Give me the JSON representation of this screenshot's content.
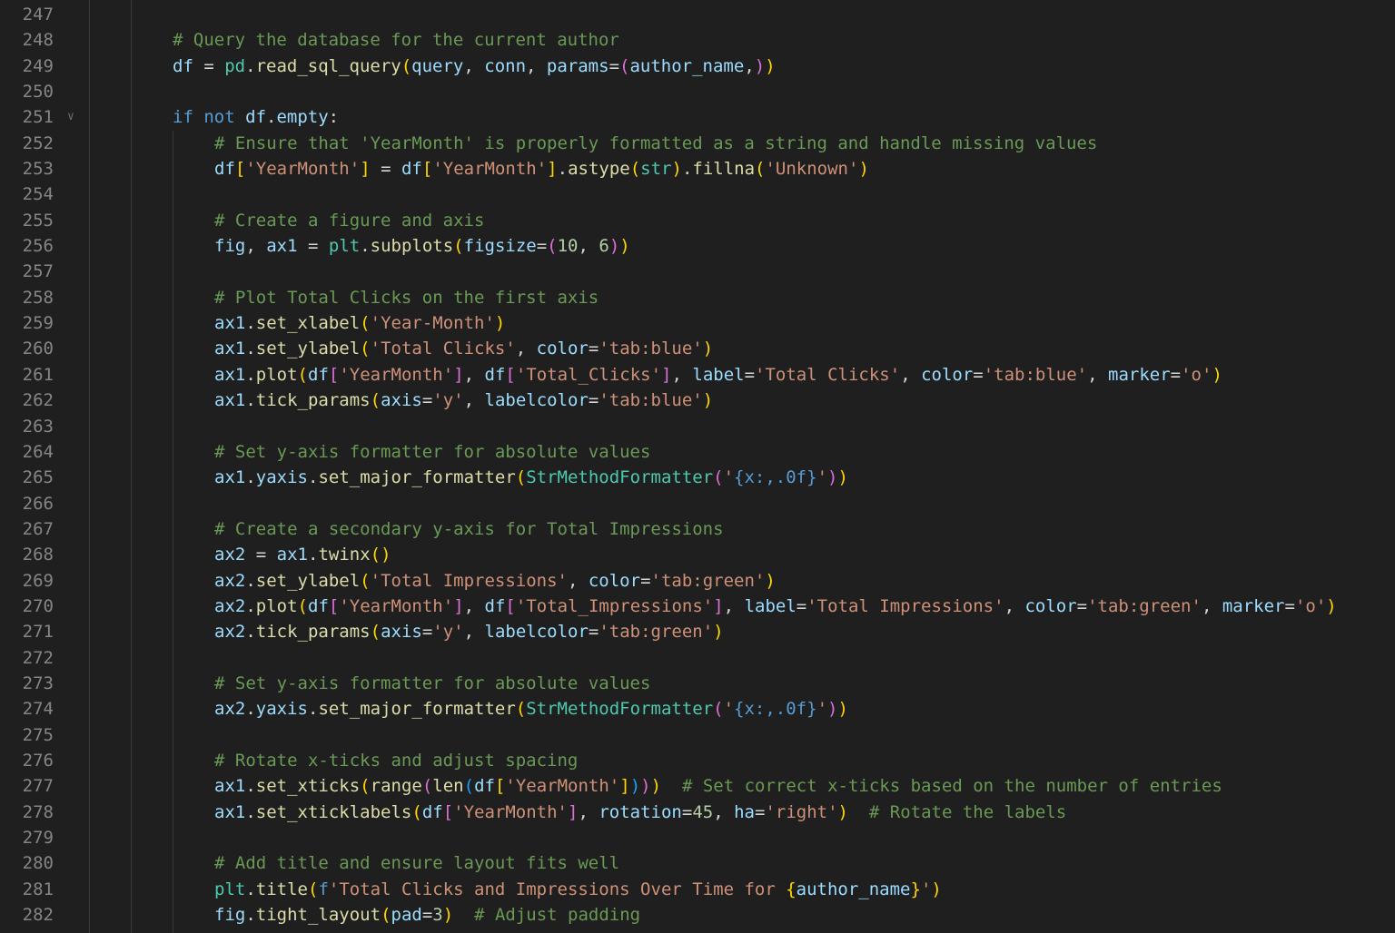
{
  "editor": {
    "language": "python",
    "lines": [
      {
        "n": "247",
        "indent": 0,
        "tokens": []
      },
      {
        "n": "248",
        "indent": 0,
        "tokens": [
          [
            "cmt",
            "# Query the database for the current author"
          ]
        ]
      },
      {
        "n": "249",
        "indent": 0,
        "tokens": [
          [
            "var",
            "df"
          ],
          [
            "p",
            " = "
          ],
          [
            "mod",
            "pd"
          ],
          [
            "p",
            "."
          ],
          [
            "fn",
            "read_sql_query"
          ],
          [
            "b1",
            "("
          ],
          [
            "var",
            "query"
          ],
          [
            "p",
            ", "
          ],
          [
            "var",
            "conn"
          ],
          [
            "p",
            ", "
          ],
          [
            "var",
            "params"
          ],
          [
            "p",
            "="
          ],
          [
            "b2",
            "("
          ],
          [
            "var",
            "author_name"
          ],
          [
            "p",
            ","
          ],
          [
            "b2",
            ")"
          ],
          [
            "b1",
            ")"
          ]
        ]
      },
      {
        "n": "250",
        "indent": 0,
        "tokens": []
      },
      {
        "n": "251",
        "indent": 0,
        "fold": true,
        "tokens": [
          [
            "kw",
            "if"
          ],
          [
            "p",
            " "
          ],
          [
            "kw",
            "not"
          ],
          [
            "p",
            " "
          ],
          [
            "var",
            "df"
          ],
          [
            "p",
            "."
          ],
          [
            "var",
            "empty"
          ],
          [
            "p",
            ":"
          ]
        ]
      },
      {
        "n": "252",
        "indent": 1,
        "tokens": [
          [
            "cmt",
            "# Ensure that 'YearMonth' is properly formatted as a string and handle missing values"
          ]
        ]
      },
      {
        "n": "253",
        "indent": 1,
        "tokens": [
          [
            "var",
            "df"
          ],
          [
            "b1",
            "["
          ],
          [
            "str",
            "'YearMonth'"
          ],
          [
            "b1",
            "]"
          ],
          [
            "p",
            " = "
          ],
          [
            "var",
            "df"
          ],
          [
            "b1",
            "["
          ],
          [
            "str",
            "'YearMonth'"
          ],
          [
            "b1",
            "]"
          ],
          [
            "p",
            "."
          ],
          [
            "fn",
            "astype"
          ],
          [
            "b1",
            "("
          ],
          [
            "cls",
            "str"
          ],
          [
            "b1",
            ")"
          ],
          [
            "p",
            "."
          ],
          [
            "fn",
            "fillna"
          ],
          [
            "b1",
            "("
          ],
          [
            "str",
            "'Unknown'"
          ],
          [
            "b1",
            ")"
          ]
        ]
      },
      {
        "n": "254",
        "indent": 1,
        "tokens": []
      },
      {
        "n": "255",
        "indent": 1,
        "tokens": [
          [
            "cmt",
            "# Create a figure and axis"
          ]
        ]
      },
      {
        "n": "256",
        "indent": 1,
        "tokens": [
          [
            "var",
            "fig"
          ],
          [
            "p",
            ", "
          ],
          [
            "var",
            "ax1"
          ],
          [
            "p",
            " = "
          ],
          [
            "mod",
            "plt"
          ],
          [
            "p",
            "."
          ],
          [
            "fn",
            "subplots"
          ],
          [
            "b1",
            "("
          ],
          [
            "var",
            "figsize"
          ],
          [
            "p",
            "="
          ],
          [
            "b2",
            "("
          ],
          [
            "num",
            "10"
          ],
          [
            "p",
            ", "
          ],
          [
            "num",
            "6"
          ],
          [
            "b2",
            ")"
          ],
          [
            "b1",
            ")"
          ]
        ]
      },
      {
        "n": "257",
        "indent": 1,
        "tokens": []
      },
      {
        "n": "258",
        "indent": 1,
        "tokens": [
          [
            "cmt",
            "# Plot Total Clicks on the first axis"
          ]
        ]
      },
      {
        "n": "259",
        "indent": 1,
        "tokens": [
          [
            "var",
            "ax1"
          ],
          [
            "p",
            "."
          ],
          [
            "fn",
            "set_xlabel"
          ],
          [
            "b1",
            "("
          ],
          [
            "str",
            "'Year-Month'"
          ],
          [
            "b1",
            ")"
          ]
        ]
      },
      {
        "n": "260",
        "indent": 1,
        "tokens": [
          [
            "var",
            "ax1"
          ],
          [
            "p",
            "."
          ],
          [
            "fn",
            "set_ylabel"
          ],
          [
            "b1",
            "("
          ],
          [
            "str",
            "'Total Clicks'"
          ],
          [
            "p",
            ", "
          ],
          [
            "var",
            "color"
          ],
          [
            "p",
            "="
          ],
          [
            "str",
            "'tab:blue'"
          ],
          [
            "b1",
            ")"
          ]
        ]
      },
      {
        "n": "261",
        "indent": 1,
        "tokens": [
          [
            "var",
            "ax1"
          ],
          [
            "p",
            "."
          ],
          [
            "fn",
            "plot"
          ],
          [
            "b1",
            "("
          ],
          [
            "var",
            "df"
          ],
          [
            "b2",
            "["
          ],
          [
            "str",
            "'YearMonth'"
          ],
          [
            "b2",
            "]"
          ],
          [
            "p",
            ", "
          ],
          [
            "var",
            "df"
          ],
          [
            "b2",
            "["
          ],
          [
            "str",
            "'Total_Clicks'"
          ],
          [
            "b2",
            "]"
          ],
          [
            "p",
            ", "
          ],
          [
            "var",
            "label"
          ],
          [
            "p",
            "="
          ],
          [
            "str",
            "'Total Clicks'"
          ],
          [
            "p",
            ", "
          ],
          [
            "var",
            "color"
          ],
          [
            "p",
            "="
          ],
          [
            "str",
            "'tab:blue'"
          ],
          [
            "p",
            ", "
          ],
          [
            "var",
            "marker"
          ],
          [
            "p",
            "="
          ],
          [
            "str",
            "'o'"
          ],
          [
            "b1",
            ")"
          ]
        ]
      },
      {
        "n": "262",
        "indent": 1,
        "tokens": [
          [
            "var",
            "ax1"
          ],
          [
            "p",
            "."
          ],
          [
            "fn",
            "tick_params"
          ],
          [
            "b1",
            "("
          ],
          [
            "var",
            "axis"
          ],
          [
            "p",
            "="
          ],
          [
            "str",
            "'y'"
          ],
          [
            "p",
            ", "
          ],
          [
            "var",
            "labelcolor"
          ],
          [
            "p",
            "="
          ],
          [
            "str",
            "'tab:blue'"
          ],
          [
            "b1",
            ")"
          ]
        ]
      },
      {
        "n": "263",
        "indent": 1,
        "tokens": []
      },
      {
        "n": "264",
        "indent": 1,
        "tokens": [
          [
            "cmt",
            "# Set y-axis formatter for absolute values"
          ]
        ]
      },
      {
        "n": "265",
        "indent": 1,
        "tokens": [
          [
            "var",
            "ax1"
          ],
          [
            "p",
            "."
          ],
          [
            "var",
            "yaxis"
          ],
          [
            "p",
            "."
          ],
          [
            "fn",
            "set_major_formatter"
          ],
          [
            "b1",
            "("
          ],
          [
            "cls",
            "StrMethodFormatter"
          ],
          [
            "b2",
            "("
          ],
          [
            "str",
            "'"
          ],
          [
            "fmt",
            "{x:,.0f}"
          ],
          [
            "str",
            "'"
          ],
          [
            "b2",
            ")"
          ],
          [
            "b1",
            ")"
          ]
        ]
      },
      {
        "n": "266",
        "indent": 1,
        "tokens": []
      },
      {
        "n": "267",
        "indent": 1,
        "tokens": [
          [
            "cmt",
            "# Create a secondary y-axis for Total Impressions"
          ]
        ]
      },
      {
        "n": "268",
        "indent": 1,
        "tokens": [
          [
            "var",
            "ax2"
          ],
          [
            "p",
            " = "
          ],
          [
            "var",
            "ax1"
          ],
          [
            "p",
            "."
          ],
          [
            "fn",
            "twinx"
          ],
          [
            "b1",
            "()"
          ]
        ]
      },
      {
        "n": "269",
        "indent": 1,
        "tokens": [
          [
            "var",
            "ax2"
          ],
          [
            "p",
            "."
          ],
          [
            "fn",
            "set_ylabel"
          ],
          [
            "b1",
            "("
          ],
          [
            "str",
            "'Total Impressions'"
          ],
          [
            "p",
            ", "
          ],
          [
            "var",
            "color"
          ],
          [
            "p",
            "="
          ],
          [
            "str",
            "'tab:green'"
          ],
          [
            "b1",
            ")"
          ]
        ]
      },
      {
        "n": "270",
        "indent": 1,
        "tokens": [
          [
            "var",
            "ax2"
          ],
          [
            "p",
            "."
          ],
          [
            "fn",
            "plot"
          ],
          [
            "b1",
            "("
          ],
          [
            "var",
            "df"
          ],
          [
            "b2",
            "["
          ],
          [
            "str",
            "'YearMonth'"
          ],
          [
            "b2",
            "]"
          ],
          [
            "p",
            ", "
          ],
          [
            "var",
            "df"
          ],
          [
            "b2",
            "["
          ],
          [
            "str",
            "'Total_Impressions'"
          ],
          [
            "b2",
            "]"
          ],
          [
            "p",
            ", "
          ],
          [
            "var",
            "label"
          ],
          [
            "p",
            "="
          ],
          [
            "str",
            "'Total Impressions'"
          ],
          [
            "p",
            ", "
          ],
          [
            "var",
            "color"
          ],
          [
            "p",
            "="
          ],
          [
            "str",
            "'tab:green'"
          ],
          [
            "p",
            ", "
          ],
          [
            "var",
            "marker"
          ],
          [
            "p",
            "="
          ],
          [
            "str",
            "'o'"
          ],
          [
            "b1",
            ")"
          ]
        ]
      },
      {
        "n": "271",
        "indent": 1,
        "tokens": [
          [
            "var",
            "ax2"
          ],
          [
            "p",
            "."
          ],
          [
            "fn",
            "tick_params"
          ],
          [
            "b1",
            "("
          ],
          [
            "var",
            "axis"
          ],
          [
            "p",
            "="
          ],
          [
            "str",
            "'y'"
          ],
          [
            "p",
            ", "
          ],
          [
            "var",
            "labelcolor"
          ],
          [
            "p",
            "="
          ],
          [
            "str",
            "'tab:green'"
          ],
          [
            "b1",
            ")"
          ]
        ]
      },
      {
        "n": "272",
        "indent": 1,
        "tokens": []
      },
      {
        "n": "273",
        "indent": 1,
        "tokens": [
          [
            "cmt",
            "# Set y-axis formatter for absolute values"
          ]
        ]
      },
      {
        "n": "274",
        "indent": 1,
        "tokens": [
          [
            "var",
            "ax2"
          ],
          [
            "p",
            "."
          ],
          [
            "var",
            "yaxis"
          ],
          [
            "p",
            "."
          ],
          [
            "fn",
            "set_major_formatter"
          ],
          [
            "b1",
            "("
          ],
          [
            "cls",
            "StrMethodFormatter"
          ],
          [
            "b2",
            "("
          ],
          [
            "str",
            "'"
          ],
          [
            "fmt",
            "{x:,.0f}"
          ],
          [
            "str",
            "'"
          ],
          [
            "b2",
            ")"
          ],
          [
            "b1",
            ")"
          ]
        ]
      },
      {
        "n": "275",
        "indent": 1,
        "tokens": []
      },
      {
        "n": "276",
        "indent": 1,
        "tokens": [
          [
            "cmt",
            "# Rotate x-ticks and adjust spacing"
          ]
        ]
      },
      {
        "n": "277",
        "indent": 1,
        "tokens": [
          [
            "var",
            "ax1"
          ],
          [
            "p",
            "."
          ],
          [
            "fn",
            "set_xticks"
          ],
          [
            "b1",
            "("
          ],
          [
            "fn",
            "range"
          ],
          [
            "b2",
            "("
          ],
          [
            "fn",
            "len"
          ],
          [
            "b3",
            "("
          ],
          [
            "var",
            "df"
          ],
          [
            "b1",
            "["
          ],
          [
            "str",
            "'YearMonth'"
          ],
          [
            "b1",
            "]"
          ],
          [
            "b3",
            ")"
          ],
          [
            "b2",
            ")"
          ],
          [
            "b1",
            ")"
          ],
          [
            "p",
            "  "
          ],
          [
            "cmt",
            "# Set correct x-ticks based on the number of entries"
          ]
        ]
      },
      {
        "n": "278",
        "indent": 1,
        "tokens": [
          [
            "var",
            "ax1"
          ],
          [
            "p",
            "."
          ],
          [
            "fn",
            "set_xticklabels"
          ],
          [
            "b1",
            "("
          ],
          [
            "var",
            "df"
          ],
          [
            "b2",
            "["
          ],
          [
            "str",
            "'YearMonth'"
          ],
          [
            "b2",
            "]"
          ],
          [
            "p",
            ", "
          ],
          [
            "var",
            "rotation"
          ],
          [
            "p",
            "="
          ],
          [
            "num",
            "45"
          ],
          [
            "p",
            ", "
          ],
          [
            "var",
            "ha"
          ],
          [
            "p",
            "="
          ],
          [
            "str",
            "'right'"
          ],
          [
            "b1",
            ")"
          ],
          [
            "p",
            "  "
          ],
          [
            "cmt",
            "# Rotate the labels"
          ]
        ]
      },
      {
        "n": "279",
        "indent": 1,
        "tokens": []
      },
      {
        "n": "280",
        "indent": 1,
        "tokens": [
          [
            "cmt",
            "# Add title and ensure layout fits well"
          ]
        ]
      },
      {
        "n": "281",
        "indent": 1,
        "tokens": [
          [
            "mod",
            "plt"
          ],
          [
            "p",
            "."
          ],
          [
            "fn",
            "title"
          ],
          [
            "b1",
            "("
          ],
          [
            "kw",
            "f"
          ],
          [
            "str",
            "'Total Clicks and Impressions Over Time for "
          ],
          [
            "b1",
            "{"
          ],
          [
            "var",
            "author_name"
          ],
          [
            "b1",
            "}"
          ],
          [
            "str",
            "'"
          ],
          [
            "b1",
            ")"
          ]
        ]
      },
      {
        "n": "282",
        "indent": 1,
        "tokens": [
          [
            "var",
            "fig"
          ],
          [
            "p",
            "."
          ],
          [
            "fn",
            "tight_layout"
          ],
          [
            "b1",
            "("
          ],
          [
            "var",
            "pad"
          ],
          [
            "p",
            "="
          ],
          [
            "num",
            "3"
          ],
          [
            "b1",
            ")"
          ],
          [
            "p",
            "  "
          ],
          [
            "cmt",
            "# Adjust padding"
          ]
        ]
      }
    ]
  }
}
